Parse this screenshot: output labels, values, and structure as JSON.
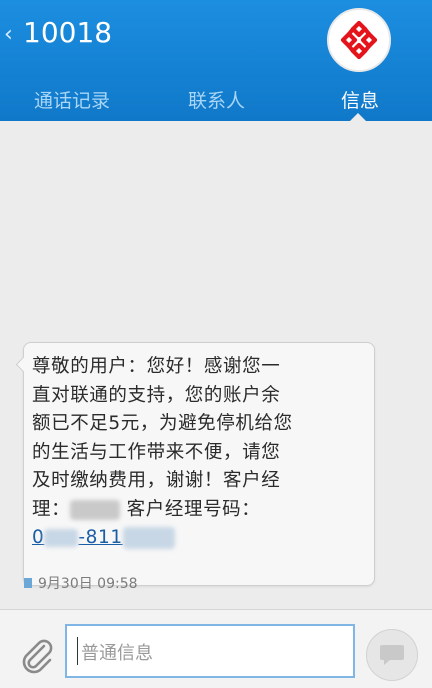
{
  "header": {
    "back_glyph": "‹",
    "title": "10018",
    "avatar_icon": "china-unicom-logo-icon",
    "brand_red": "#e3141b"
  },
  "tabs": [
    {
      "label": "通话记录",
      "active": false
    },
    {
      "label": "联系人",
      "active": false
    },
    {
      "label": "信息",
      "active": true
    }
  ],
  "message": {
    "lines": [
      "尊敬的用户：您好！感谢您一",
      "直对联通的支持，您的账户余",
      "额已不足5元，为避免停机给您",
      "的生活与工作带来不便，请您",
      "及时缴纳费用，谢谢！客户经"
    ],
    "line6_prefix": "理：",
    "line6_suffix": " 客户经理号码：",
    "phone_part1": "0",
    "phone_part2": "-811",
    "timestamp": "9月30日 09:58"
  },
  "compose": {
    "placeholder": "普通信息",
    "attach_icon": "paperclip-icon",
    "send_icon": "send-icon"
  },
  "colors": {
    "header_blue": "#1a86d8",
    "link_blue": "#1a5fa6"
  }
}
